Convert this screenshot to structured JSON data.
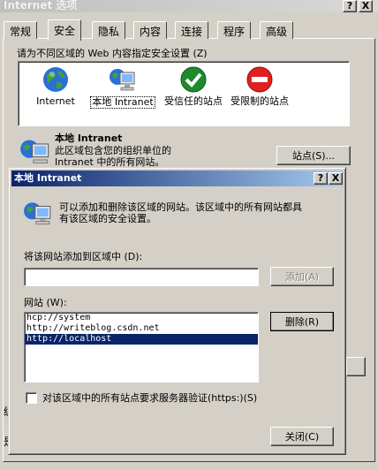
{
  "bg_window": {
    "title": "Internet 选项",
    "title_buttons": [
      "?",
      "X"
    ],
    "tabs": [
      "常规",
      "安全",
      "隐私",
      "内容",
      "连接",
      "程序",
      "高级"
    ],
    "active_tab": "安全",
    "zone_prompt": "请为不同区域的 Web 内容指定安全设置 (Z)",
    "zones": [
      {
        "label": "Internet",
        "icon": "globe-icon"
      },
      {
        "label": "本地 Intranet",
        "icon": "intranet-icon"
      },
      {
        "label": "受信任的站点",
        "icon": "check-icon"
      },
      {
        "label": "受限制的站点",
        "icon": "restricted-icon"
      }
    ],
    "selected_zone_title": "本地 Intranet",
    "selected_zone_desc_1": "此区域包含您的组织单位的",
    "selected_zone_desc_2": "Intranet 中的所有网站。",
    "sites_button": "站点(S)...",
    "left_edge_text_1": "级",
    "left_edge_text_2": "是"
  },
  "dialog": {
    "title": "本地 Intranet",
    "title_buttons": [
      "?",
      "X"
    ],
    "info_text_1": "可以添加和删除该区域的网站。该区域中的所有网站都具",
    "info_text_2": "有该区域的安全设置。",
    "add_label": "将该网站添加到区域中 (D):",
    "add_input_value": "",
    "add_button": "添加(A)",
    "sites_label": "网站 (W):",
    "sites": [
      "hcp://system",
      "http://writeblog.csdn.net",
      "http://localhost"
    ],
    "selected_site_index": 2,
    "remove_button": "删除(R)",
    "require_https_label": "对该区域中的所有站点要求服务器验证(https:)(S)",
    "require_https_checked": false,
    "close_button": "关闭(C)"
  },
  "colors": {
    "titlebar_active": "#0a246a",
    "face": "#d4d0c8",
    "selection": "#0a246a"
  }
}
